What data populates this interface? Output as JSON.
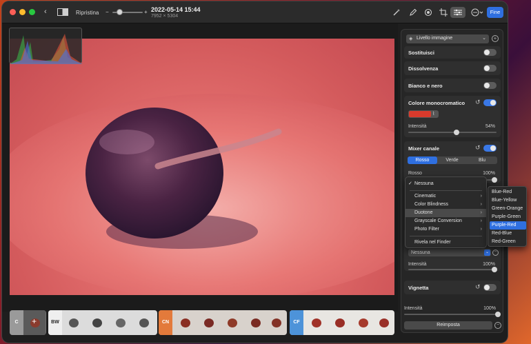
{
  "toolbar": {
    "back_icon": "chevron-left-icon",
    "compare_icon": "split-view-icon",
    "revert_label": "Ripristina",
    "zoom_minus": "−",
    "zoom_plus": "+",
    "title": "2022-05-14 15:44",
    "subtitle": "7952 × 5304",
    "done_label": "Fine",
    "icons": [
      "magic-wand-icon",
      "markup-icon",
      "filters-icon",
      "crop-icon",
      "adjust-icon",
      "more-icon"
    ]
  },
  "panel": {
    "layer_select": "Livello immagine",
    "sections": {
      "sostituisci": "Sostituisci",
      "dissolvenza": "Dissolvenza",
      "bianco_nero": "Bianco e nero",
      "colore_mono": "Colore monocromatico",
      "mono_intensity_label": "Intensità",
      "mono_intensity_value": "54%",
      "mono_intensity_level": 0.54,
      "mono_color": "#d83a2c",
      "mixer": "Mixer canale",
      "mixer_tabs": [
        "Rosso",
        "Verde",
        "Blu"
      ],
      "mixer_active_tab": "Rosso",
      "rosso_label": "Rosso",
      "rosso_value": "100%",
      "lut_select": "Nessuna",
      "lut_intensity_label": "Intensità",
      "lut_intensity_value": "100%",
      "vignetta": "Vignetta",
      "bottom_intensity_label": "Intensità",
      "bottom_intensity_value": "100%",
      "reset_label": "Reimposta"
    }
  },
  "menu": {
    "checked": "✓",
    "items": [
      "Nessuna",
      "Cinematic",
      "Color Blindness",
      "Duotone",
      "Grayscale Conversion",
      "Photo Filter",
      "Rivela nel Finder"
    ],
    "highlighted": "Duotone"
  },
  "submenu": {
    "items": [
      "Blue-Red",
      "Blue-Yellow",
      "Green-Orange",
      "Purple-Green",
      "Purple-Red",
      "Red-Blue",
      "Red-Green"
    ],
    "selected": "Purple-Red"
  },
  "filmstrip": {
    "groups": [
      {
        "tag": "C",
        "color": "#9a9a9a"
      },
      {
        "tag": "BW",
        "color": "#eeeeee"
      },
      {
        "tag": "CN",
        "color": "#e37a3b"
      },
      {
        "tag": "CF",
        "color": "#4d93d9"
      }
    ]
  }
}
